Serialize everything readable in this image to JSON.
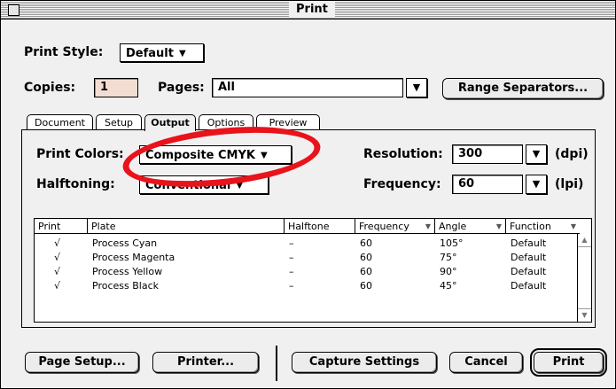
{
  "window": {
    "title": "Print"
  },
  "print_style": {
    "label": "Print Style:",
    "value": "Default"
  },
  "copies": {
    "label": "Copies:",
    "value": "1"
  },
  "pages": {
    "label": "Pages:",
    "value": "All"
  },
  "range_button": {
    "label": "Range Separators..."
  },
  "tabs": [
    {
      "label": "Document"
    },
    {
      "label": "Setup"
    },
    {
      "label": "Output",
      "active": true
    },
    {
      "label": "Options"
    },
    {
      "label": "Preview"
    }
  ],
  "output": {
    "print_colors": {
      "label": "Print Colors:",
      "value": "Composite CMYK"
    },
    "halftoning": {
      "label": "Halftoning:",
      "value": "Conventional"
    },
    "resolution": {
      "label": "Resolution:",
      "value": "300",
      "unit": "(dpi)"
    },
    "frequency": {
      "label": "Frequency:",
      "value": "60",
      "unit": "(lpi)"
    }
  },
  "plates_table": {
    "headers": [
      "Print",
      "Plate",
      "Halftone",
      "Frequency",
      "Angle",
      "Function"
    ],
    "rows": [
      {
        "print": "√",
        "plate": "Process Cyan",
        "halftone": "–",
        "frequency": "60",
        "angle": "105°",
        "function": "Default"
      },
      {
        "print": "√",
        "plate": "Process Magenta",
        "halftone": "–",
        "frequency": "60",
        "angle": "75°",
        "function": "Default"
      },
      {
        "print": "√",
        "plate": "Process Yellow",
        "halftone": "–",
        "frequency": "60",
        "angle": "90°",
        "function": "Default"
      },
      {
        "print": "√",
        "plate": "Process Black",
        "halftone": "–",
        "frequency": "60",
        "angle": "45°",
        "function": "Default"
      }
    ]
  },
  "buttons": {
    "page_setup": "Page Setup...",
    "printer": "Printer...",
    "capture_settings": "Capture Settings",
    "cancel": "Cancel",
    "print": "Print"
  },
  "icons": {
    "dropdown": "▼",
    "sort": "▼",
    "scroll_up": "▲",
    "scroll_down": "▼"
  },
  "colors": {
    "highlight_ring": "#e8131b",
    "copies_field_bg": "#f3ddd3"
  }
}
